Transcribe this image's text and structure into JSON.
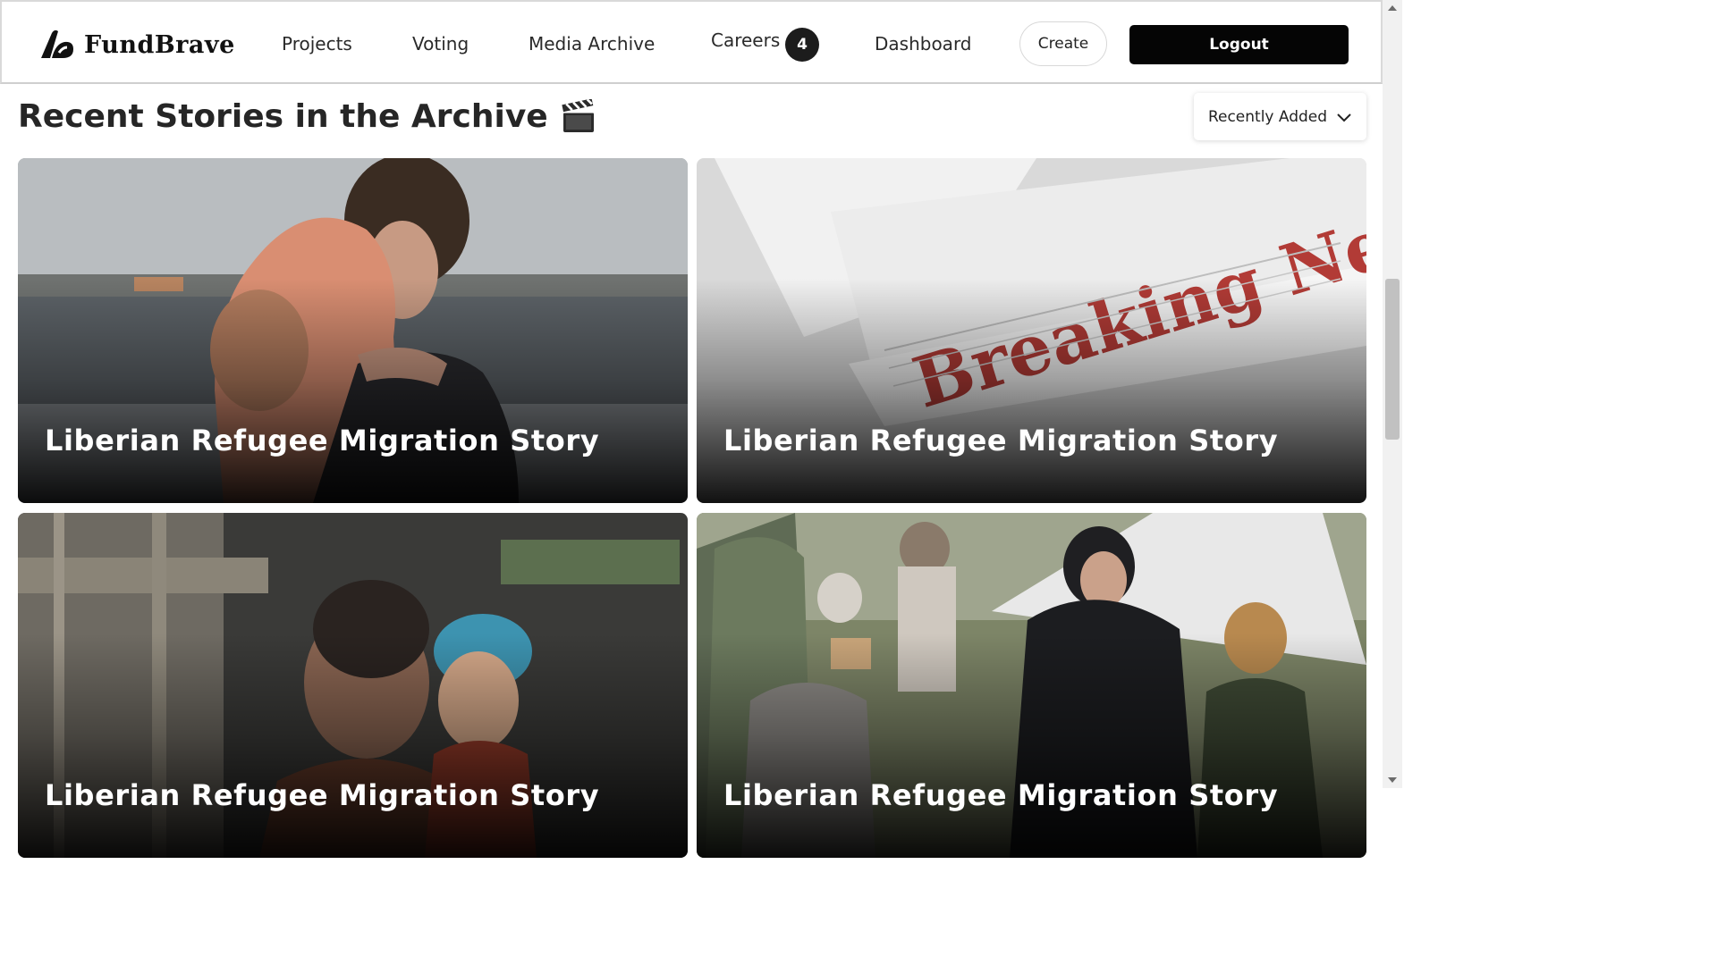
{
  "brand": {
    "name": "FundBrave",
    "logo_icon": "fundbrave-logo-icon"
  },
  "nav": {
    "projects": "Projects",
    "voting": "Voting",
    "media_archive": "Media Archive",
    "careers": "Careers",
    "careers_badge": "4",
    "dashboard": "Dashboard",
    "create": "Create",
    "logout": "Logout"
  },
  "section": {
    "title": "Recent Stories in the Archive",
    "title_icon": "clapperboard-icon",
    "sort_label": "Recently Added",
    "sort_icon": "chevron-down-icon"
  },
  "stories": [
    {
      "title": "Liberian Refugee Migration Story",
      "image": "mother-hugging-child-by-lake"
    },
    {
      "title": "Liberian Refugee Migration Story",
      "image": "breaking-news-newspaper"
    },
    {
      "title": "Liberian Refugee Migration Story",
      "image": "woman-holding-child-in-shelter"
    },
    {
      "title": "Liberian Refugee Migration Story",
      "image": "refugee-camp-aid-distribution"
    }
  ],
  "colors": {
    "primary": "#050505",
    "badge": "#1c1c1c",
    "text": "#262626"
  }
}
